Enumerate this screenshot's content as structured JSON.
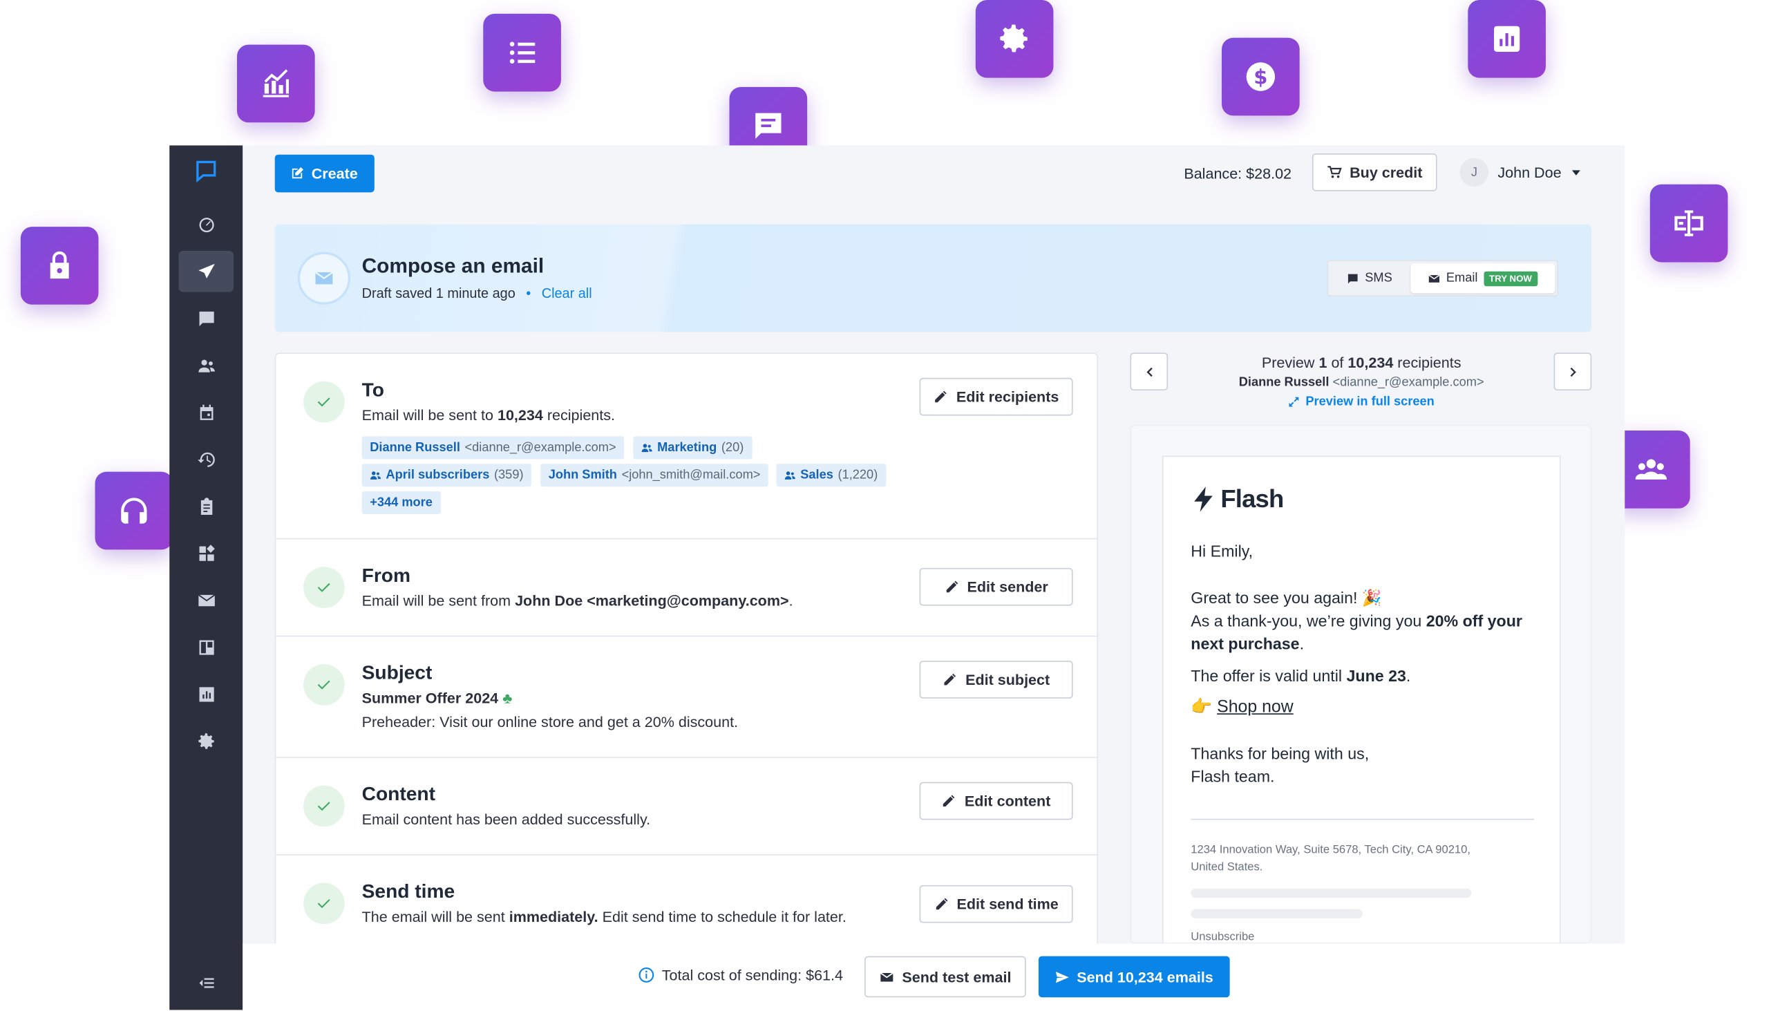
{
  "topbar": {
    "create_label": "Create",
    "balance_text": "Balance: $28.02",
    "buy_credit_label": "Buy credit",
    "user_initial": "J",
    "user_name": "John Doe"
  },
  "compose": {
    "title": "Compose an email",
    "draft_status": "Draft saved 1 minute ago",
    "separator": "•",
    "clear_all_label": "Clear all",
    "channels": [
      {
        "label": "SMS",
        "icon": "sms-icon"
      },
      {
        "label": "Email",
        "icon": "envelope-icon",
        "badge": "TRY NOW"
      }
    ]
  },
  "sections": {
    "to": {
      "title": "To",
      "text_prefix": "Email will be sent to ",
      "count": "10,234",
      "text_suffix": " recipients.",
      "edit_label": "Edit recipients",
      "chips": [
        {
          "name": "Dianne Russell",
          "detail": "<dianne_r@example.com>",
          "group": false
        },
        {
          "name": "Marketing",
          "detail": "(20)",
          "group": true
        },
        {
          "name": "April subscribers",
          "detail": "(359)",
          "group": true
        },
        {
          "name": "John Smith",
          "detail": "<john_smith@mail.com>",
          "group": false
        },
        {
          "name": "Sales",
          "detail": "(1,220)",
          "group": true
        },
        {
          "name": "+344 more",
          "detail": "",
          "group": false
        }
      ]
    },
    "from": {
      "title": "From",
      "text_prefix": "Email will be sent from ",
      "sender": "John Doe <marketing@company.com>",
      "text_suffix": ".",
      "edit_label": "Edit sender"
    },
    "subject": {
      "title": "Subject",
      "subject_line": "Summer Offer 2024",
      "preheader": "Preheader: Visit our online store and get a 20% discount.",
      "edit_label": "Edit subject"
    },
    "content": {
      "title": "Content",
      "text": "Email content has been added successfully.",
      "edit_label": "Edit content"
    },
    "send_time": {
      "title": "Send time",
      "text_prefix": "The email will be sent ",
      "emphasis": "immediately.",
      "text_suffix": " Edit send time to schedule it for later.",
      "edit_label": "Edit send time"
    }
  },
  "preview": {
    "label_prefix": "Preview ",
    "current": "1",
    "label_mid": " of ",
    "total": "10,234",
    "label_suffix": " recipients",
    "recipient_name": "Dianne Russell",
    "recipient_email": "<dianne_r@example.com>",
    "fullscreen_label": "Preview in full screen"
  },
  "email": {
    "brand": "Flash",
    "greeting": "Hi Emily,",
    "line1": "Great to see you again! 🎉",
    "line2_prefix": "As a thank-you, we’re giving you ",
    "line2_bold": "20% off your",
    "line3_bold": "next purchase",
    "line3_suffix": ".",
    "line4_prefix": "The offer is valid until ",
    "line4_bold": "June 23",
    "line4_suffix": ".",
    "cta_emoji": "👉",
    "cta_label": "Shop now",
    "closing1": "Thanks for being with us,",
    "closing2": "Flash team.",
    "address1": "1234 Innovation Way, Suite 5678, Tech City, CA 90210,",
    "address2": "United States.",
    "unsubscribe": "Unsubscribe"
  },
  "bottom": {
    "total_cost": "Total cost of sending: $61.4",
    "send_test_label": "Send test email",
    "send_label": "Send 10,234 emails"
  },
  "colors": {
    "primary": "#0b84e8",
    "sidebar": "#2b2f3e",
    "accent_gradient_start": "#7c4ddb",
    "accent_gradient_end": "#9b3fd2",
    "success": "#3ea862",
    "badge": "#3ea862"
  }
}
